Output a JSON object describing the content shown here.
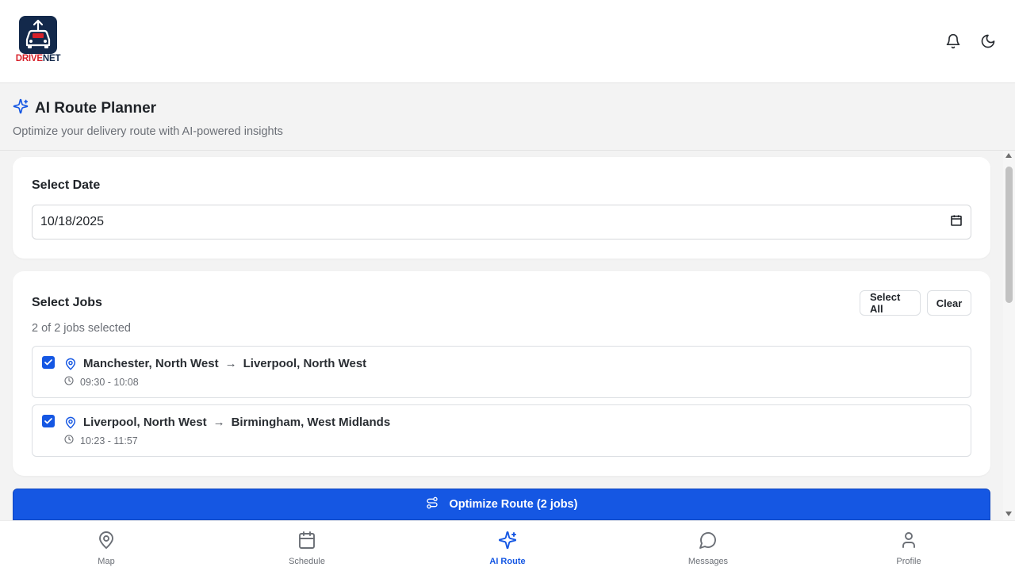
{
  "brand": {
    "name_part1": "DRIVE",
    "name_part2": "NET"
  },
  "header": {
    "notifications_icon": "bell-icon",
    "theme_icon": "moon-icon"
  },
  "page": {
    "title": "AI Route Planner",
    "subtitle": "Optimize your delivery route with AI-powered insights",
    "title_icon": "sparkles-icon"
  },
  "date_section": {
    "title": "Select Date",
    "value": "10/18/2025"
  },
  "jobs_section": {
    "title": "Select Jobs",
    "select_all_label": "Select All",
    "clear_label": "Clear",
    "count_text": "2 of 2 jobs selected",
    "jobs": [
      {
        "from": "Manchester, North West",
        "arrow": "→",
        "to": "Liverpool, North West",
        "time": "09:30 - 10:08",
        "checked": true
      },
      {
        "from": "Liverpool, North West",
        "arrow": "→",
        "to": "Birmingham, West Midlands",
        "time": "10:23 - 11:57",
        "checked": true
      }
    ]
  },
  "optimize_button": {
    "label": "Optimize Route (2 jobs)"
  },
  "bottom_nav": [
    {
      "label": "Map",
      "icon": "map-pin-icon",
      "active": false
    },
    {
      "label": "Schedule",
      "icon": "calendar-icon",
      "active": false
    },
    {
      "label": "AI Route",
      "icon": "sparkles-icon",
      "active": true
    },
    {
      "label": "Messages",
      "icon": "chat-bubble-icon",
      "active": false
    },
    {
      "label": "Profile",
      "icon": "user-icon",
      "active": false
    }
  ],
  "colors": {
    "accent": "#1557e3",
    "brand_navy": "#13294b",
    "brand_red": "#d7212a"
  }
}
